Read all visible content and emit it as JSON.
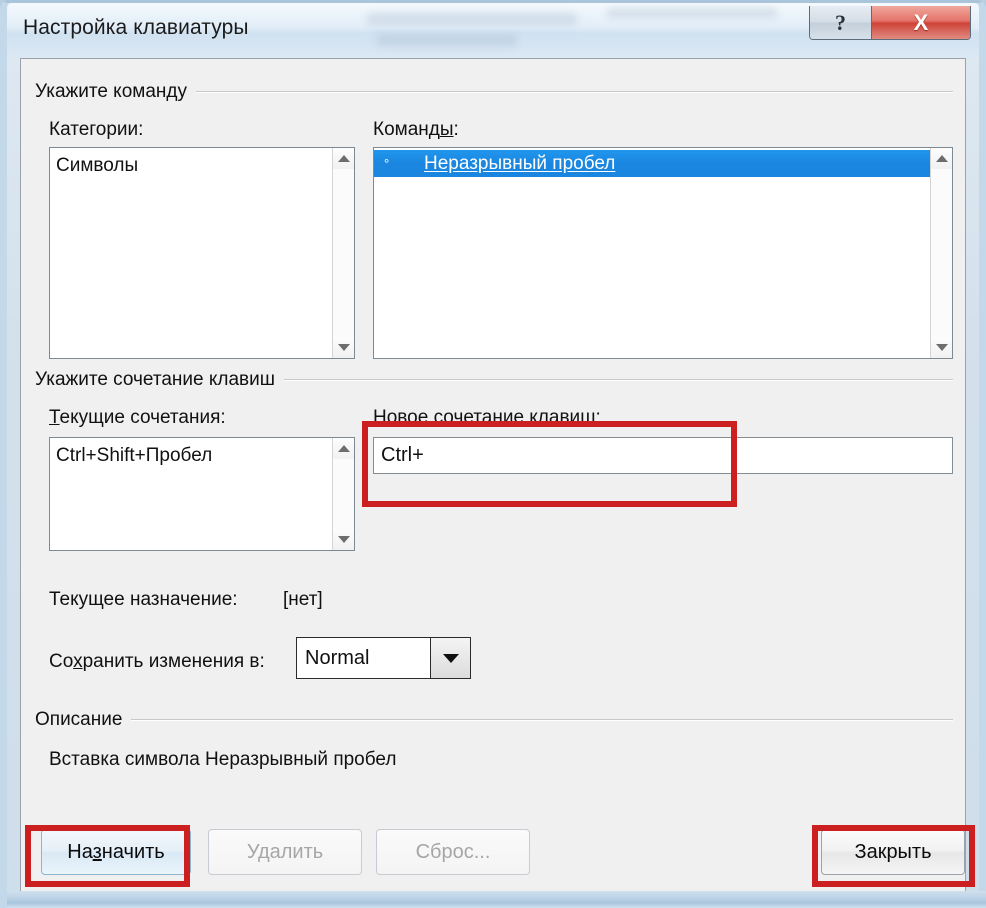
{
  "window": {
    "title": "Настройка клавиатуры",
    "help_button": "?",
    "close_button": "X",
    "accent_red": "#cc1f1f",
    "selection_blue": "#1a86df"
  },
  "groups": {
    "command": "Укажите команду",
    "shortcut": "Укажите сочетание клавиш",
    "description": "Описание"
  },
  "categories": {
    "label": "Категории:",
    "items": [
      "Символы"
    ],
    "selected_index": -1
  },
  "commands": {
    "label_prefix": "Команд",
    "label_accel": "ы",
    "label_suffix": ":",
    "items": [
      {
        "bullet": "°",
        "text": "Неразрывный пробел",
        "selected": true
      }
    ]
  },
  "current_shortcuts": {
    "label_accel": "Т",
    "label_suffix": "екущие сочетания:",
    "items": [
      "Ctrl+Shift+Пробел"
    ]
  },
  "new_shortcut": {
    "label_prefix": "Новое сочетание клави",
    "label_accel": "ш",
    "label_suffix": ":",
    "value": "Ctrl+"
  },
  "current_assignment": {
    "label": "Текущее назначение:",
    "value": "[нет]"
  },
  "save_in": {
    "label_prefix": "Со",
    "label_accel": "х",
    "label_suffix": "ранить изменения в:",
    "value": "Normal"
  },
  "description": {
    "text": "Вставка символа Неразрывный пробел"
  },
  "buttons": {
    "assign_prefix": "На",
    "assign_accel": "з",
    "assign_suffix": "начить",
    "delete": "Удалить",
    "reset": "Сброс...",
    "close": "Закрыть"
  }
}
